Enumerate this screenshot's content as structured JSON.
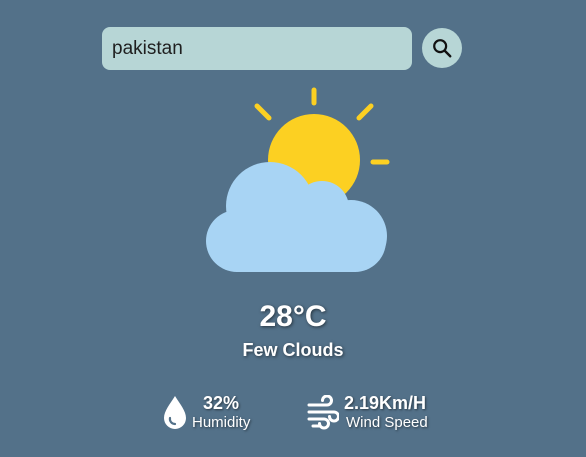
{
  "search": {
    "value": "pakistan",
    "button_icon": "search-icon"
  },
  "weather": {
    "icon": "partly-cloudy-icon",
    "temperature": "28°C",
    "description": "Few Clouds"
  },
  "details": {
    "humidity": {
      "icon": "water-drop-icon",
      "value": "32%",
      "label": "Humidity"
    },
    "wind": {
      "icon": "wind-icon",
      "value": "2.19Km/H",
      "label": "Wind Speed"
    }
  },
  "colors": {
    "background": "#537189",
    "input_background": "#b7d6d6",
    "sun": "#fcd022",
    "cloud": "#a8d4f4",
    "text": "#ffffff"
  }
}
